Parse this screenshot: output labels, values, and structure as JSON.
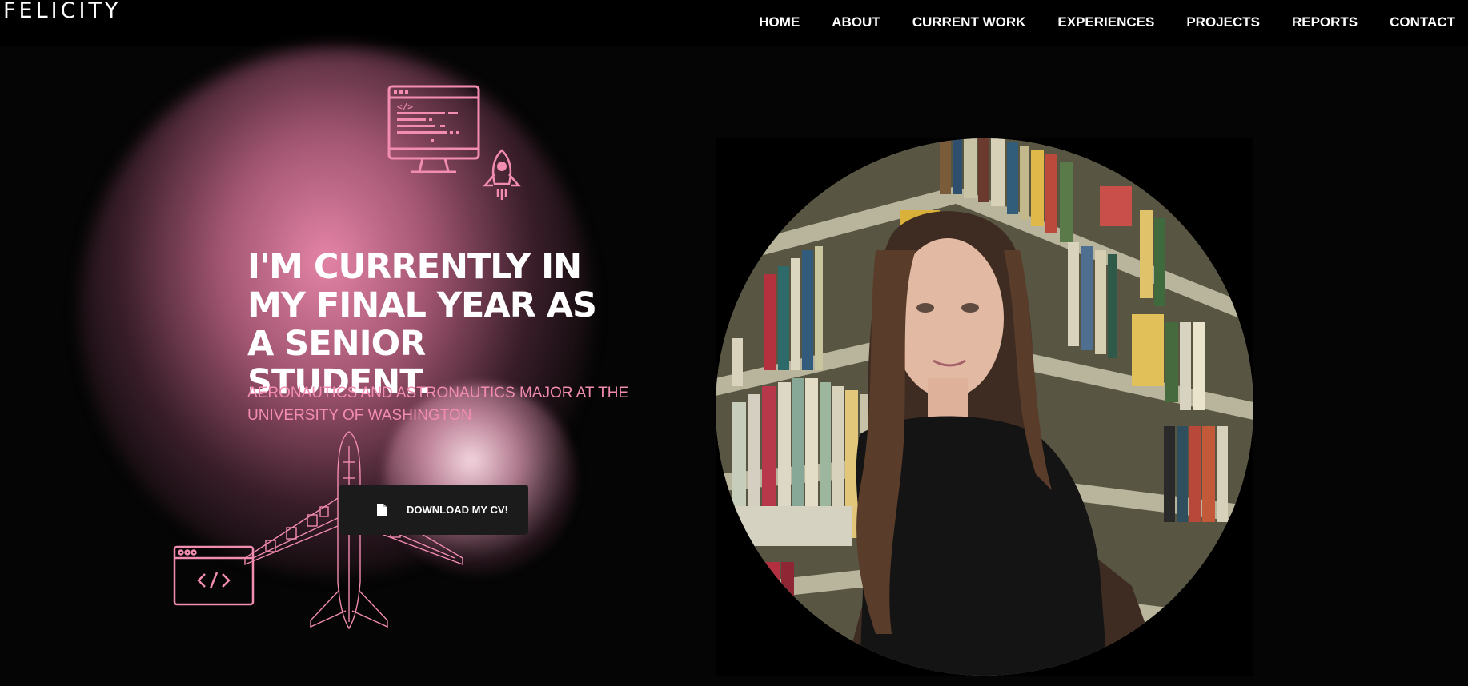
{
  "brand": {
    "logo": "FELICITY"
  },
  "nav": {
    "items": [
      {
        "label": "HOME"
      },
      {
        "label": "ABOUT"
      },
      {
        "label": "CURRENT WORK"
      },
      {
        "label": "EXPERIENCES"
      },
      {
        "label": "PROJECTS"
      },
      {
        "label": "REPORTS"
      },
      {
        "label": "CONTACT"
      }
    ]
  },
  "hero": {
    "headline": "I'M CURRENTLY IN MY FINAL YEAR AS A SENIOR STUDENT.",
    "subtitle": "AERONAUTICS AND ASTRONAUTICS MAJOR AT THE UNIVERSITY OF WASHINGTON",
    "cv_button_label": "DOWNLOAD MY CV!",
    "cv_button_icon": "file-icon"
  },
  "decorations": {
    "icons": [
      "monitor-code-icon",
      "rocket-icon",
      "browser-code-icon",
      "airplane-icon"
    ],
    "accent_color": "#f28cb0"
  },
  "profile_photo": {
    "alt": "portrait-photo"
  }
}
